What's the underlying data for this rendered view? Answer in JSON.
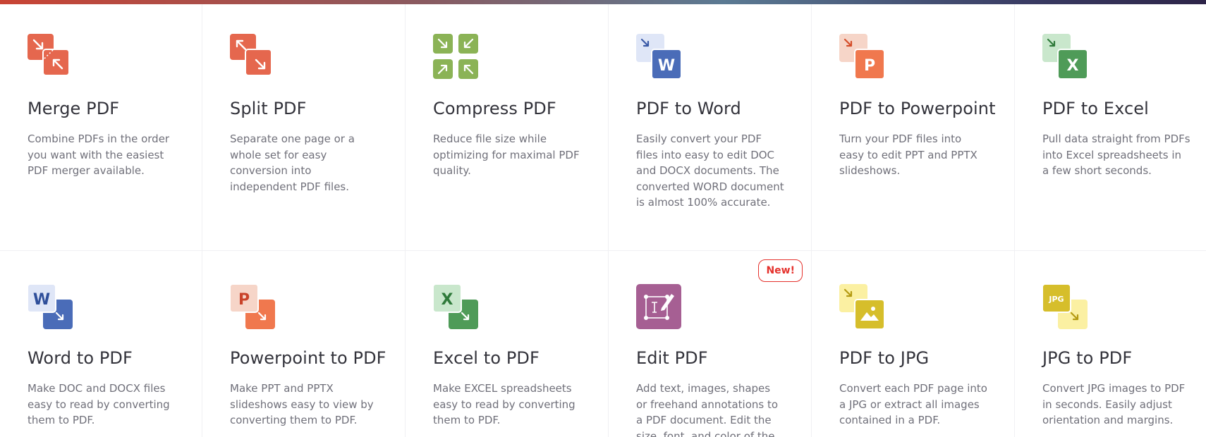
{
  "tools": [
    {
      "title": "Merge PDF",
      "desc": "Combine PDFs in the order you want with the easiest PDF merger available.",
      "icon": "merge-pdf-icon"
    },
    {
      "title": "Split PDF",
      "desc": "Separate one page or a whole set for easy conversion into independent PDF files.",
      "icon": "split-pdf-icon"
    },
    {
      "title": "Compress PDF",
      "desc": "Reduce file size while optimizing for maximal PDF quality.",
      "icon": "compress-pdf-icon"
    },
    {
      "title": "PDF to Word",
      "desc": "Easily convert your PDF files into easy to edit DOC and DOCX documents. The converted WORD document is almost 100% accurate.",
      "icon": "pdf-to-word-icon"
    },
    {
      "title": "PDF to Powerpoint",
      "desc": "Turn your PDF files into easy to edit PPT and PPTX slideshows.",
      "icon": "pdf-to-powerpoint-icon"
    },
    {
      "title": "PDF to Excel",
      "desc": "Pull data straight from PDFs into Excel spreadsheets in a few short seconds.",
      "icon": "pdf-to-excel-icon"
    },
    {
      "title": "Word to PDF",
      "desc": "Make DOC and DOCX files easy to read by converting them to PDF.",
      "icon": "word-to-pdf-icon"
    },
    {
      "title": "Powerpoint to PDF",
      "desc": "Make PPT and PPTX slideshows easy to view by converting them to PDF.",
      "icon": "powerpoint-to-pdf-icon"
    },
    {
      "title": "Excel to PDF",
      "desc": "Make EXCEL spreadsheets easy to read by converting them to PDF.",
      "icon": "excel-to-pdf-icon"
    },
    {
      "title": "Edit PDF",
      "desc": "Add text, images, shapes or freehand annotations to a PDF document. Edit the size, font, and color of the",
      "icon": "edit-pdf-icon",
      "badge": "New!"
    },
    {
      "title": "PDF to JPG",
      "desc": "Convert each PDF page into a JPG or extract all images contained in a PDF.",
      "icon": "pdf-to-jpg-icon"
    },
    {
      "title": "JPG to PDF",
      "desc": "Convert JPG images to PDF in seconds. Easily adjust orientation and margins.",
      "icon": "jpg-to-pdf-icon"
    }
  ],
  "icon_letters": {
    "word": "W",
    "powerpoint": "P",
    "excel": "X",
    "jpg": "JPG"
  },
  "colors": {
    "merge": "#e5674e",
    "compress": "#8bb356",
    "word": "#4a6cb8",
    "word_light": "#dfe6f7",
    "powerpoint": "#f0784e",
    "powerpoint_light": "#f6d5c8",
    "excel": "#4f9b58",
    "excel_light": "#c9e7cc",
    "edit": "#a65f93",
    "jpg": "#d6be2b",
    "jpg_light": "#fbf0a2",
    "badge": "#e5322d"
  }
}
